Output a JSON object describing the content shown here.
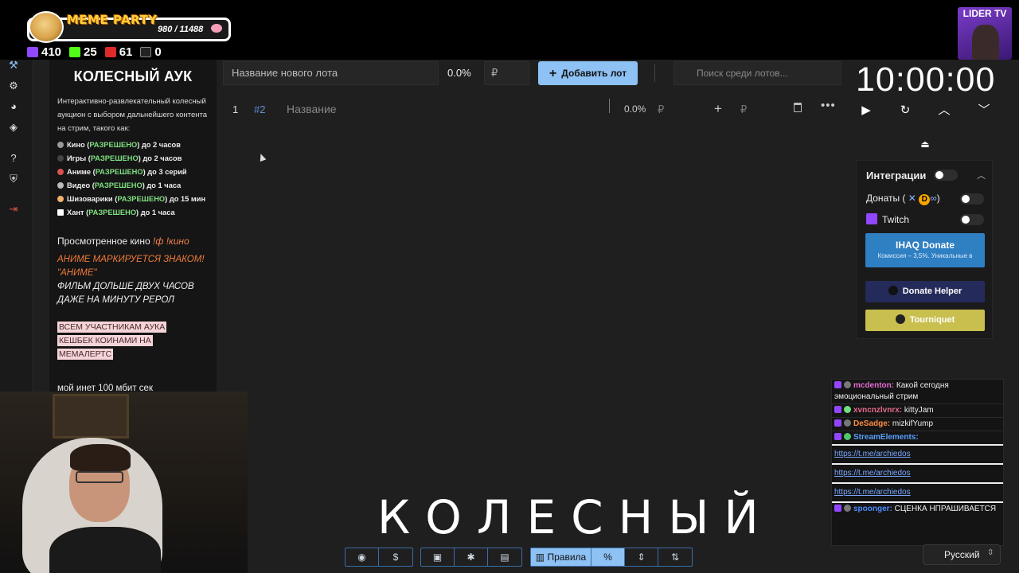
{
  "overlay": {
    "meme_title": "MEME PARTY",
    "meme_count": "980 / 11488",
    "stats": [
      "410",
      "25",
      "61",
      "0"
    ],
    "lider_label": "LIDER TV"
  },
  "rules": {
    "title": "КОЛЕСНЫЙ АУК",
    "intro": "Интерактивно-развлекательный колесный аукцион с выбором дальнейшего контента на стрим, такого как:",
    "items": [
      {
        "name": "Кино",
        "ok": "РАЗРЕШЕНО",
        "limit": "до 2 часов"
      },
      {
        "name": "Игры",
        "ok": "РАЗРЕШЕНО",
        "limit": "до 2 часов"
      },
      {
        "name": "Аниме",
        "ok": "РАЗРЕШЕНО",
        "limit": "до 3 серий"
      },
      {
        "name": "Видео",
        "ok": "РАЗРЕШЕНО",
        "limit": "до 1 часа"
      },
      {
        "name": "Шизоварики",
        "ok": "РАЗРЕШЕНО",
        "limit": "до 15 мин"
      },
      {
        "name": "Хант",
        "ok": "РАЗРЕШЕНО",
        "limit": "до 1 часа"
      }
    ],
    "viewed_label": "Просмотренное кино",
    "viewed_cmd": "!ф !кино",
    "anime_line1": "АНИМЕ МАРКИРУЕТСЯ ЗНАКОМ!",
    "anime_line2": "\"АНИМЕ\"",
    "film_line": "ФИЛЬМ ДОЛЬШЕ ДВУХ ЧАСОВ ДАЖЕ НА МИНУТУ РЕРОЛ",
    "cashback_1": "ВСЕМ УЧАСТНИКАМ АУКА",
    "cashback_2": "КЕШБЕК КОИНАМИ НА",
    "cashback_3": "МЕМАЛЕРТС",
    "net": "мой инет 100 мбит сек"
  },
  "topbar": {
    "lot_placeholder": "Название нового лота",
    "percent": "0.0%",
    "currency": "₽",
    "add_label": "Добавить лот",
    "search_placeholder": "Поиск среди лотов..."
  },
  "lots": [
    {
      "index": "1",
      "number": "#2",
      "name": "Название",
      "percent": "0.0%",
      "currency": "₽",
      "plus": "+",
      "currency2": "₽"
    }
  ],
  "timer": {
    "value": "10:00:00"
  },
  "integrations": {
    "title": "Интеграции",
    "donations_label": "Донаты (",
    "donations_suffix": ")",
    "twitch_label": "Twitch",
    "ihaq_title": "IHAQ Donate",
    "ihaq_sub": "Комиссия – 3,5%. Уникальные в",
    "donate_helper": "Donate Helper",
    "tourniquet": "Tourniquet"
  },
  "chat": [
    {
      "user": "mcdenton:",
      "text": "Какой сегодня эмоциональный стрим",
      "color": "pink"
    },
    {
      "user": "xvncnzlvnrx:",
      "text": "kittyJam",
      "color": "pink"
    },
    {
      "user": "DeSadge:",
      "text": "mizkifYump",
      "color": "orange"
    },
    {
      "user": "StreamElements:",
      "text": "",
      "color": "blue"
    }
  ],
  "chat_links": [
    "https://t.me/archiedos",
    "https://t.me/archiedos",
    "https://t.me/archiedos"
  ],
  "chat_last": {
    "user": "spoonger:",
    "text": "СЦЕНКА НПРАШИВАЕТСЯ"
  },
  "big_word": "КОЛЕСНЫЙ",
  "toolbar": {
    "rules_label": "Правила",
    "dollar": "$",
    "percent_sym": "%"
  },
  "language": "Русский"
}
